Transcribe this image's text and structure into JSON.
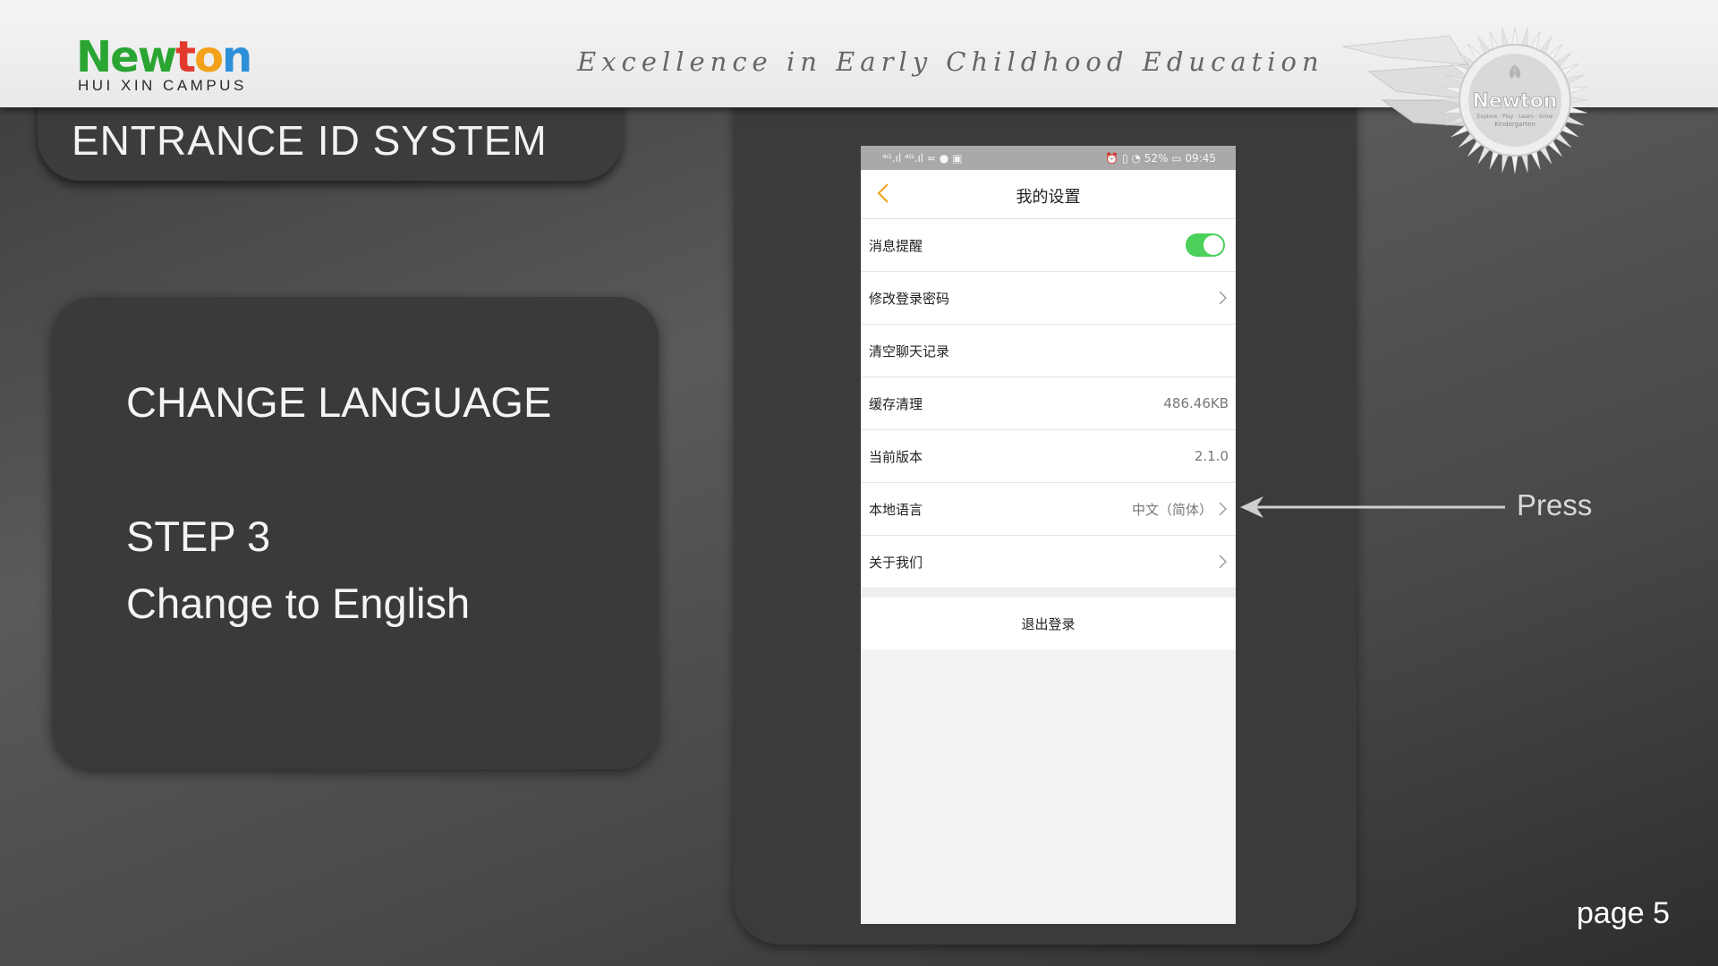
{
  "header": {
    "logo_letters": [
      {
        "ch": "N",
        "color": "#2aa532"
      },
      {
        "ch": "e",
        "color": "#2aa532"
      },
      {
        "ch": "w",
        "color": "#2aa532"
      },
      {
        "ch": "t",
        "color": "#e23b2e"
      },
      {
        "ch": "o",
        "color": "#f2a21a"
      },
      {
        "ch": "n",
        "color": "#2d8fd9"
      }
    ],
    "logo_sub": "HUI XIN CAMPUS",
    "tagline": "Excellence in Early Childhood Education",
    "badge": {
      "title": "Newton",
      "motto": "Explore · Play · Learn · Grow",
      "subtitle": "Kindergarten"
    }
  },
  "slide": {
    "section_title": "ENTRANCE ID SYSTEM",
    "heading": "CHANGE LANGUAGE",
    "step": "STEP 3",
    "instruction": "Change to English",
    "callout": "Press",
    "page": "page 5"
  },
  "phone": {
    "status_left": "⁴ᴳ.ıl ⁴ᴳ.ıl ≈ ● ▣",
    "status_right": "⏰ ▯ ◔ 52% ▭ 09:45",
    "title": "我的设置",
    "settings": [
      {
        "label": "消息提醒",
        "value": "",
        "toggle": true,
        "chevron": false
      },
      {
        "label": "修改登录密码",
        "value": "",
        "toggle": false,
        "chevron": true
      },
      {
        "label": "清空聊天记录",
        "value": "",
        "toggle": false,
        "chevron": false
      },
      {
        "label": "缓存清理",
        "value": "486.46KB",
        "toggle": false,
        "chevron": false
      },
      {
        "label": "当前版本",
        "value": "2.1.0",
        "toggle": false,
        "chevron": false
      },
      {
        "label": "本地语言",
        "value": "中文（简体）",
        "toggle": false,
        "chevron": true
      },
      {
        "label": "关于我们",
        "value": "",
        "toggle": false,
        "chevron": true
      }
    ],
    "logout": "退出登录",
    "accent_color": "#f2a21a",
    "toggle_color": "#4cd15b"
  }
}
